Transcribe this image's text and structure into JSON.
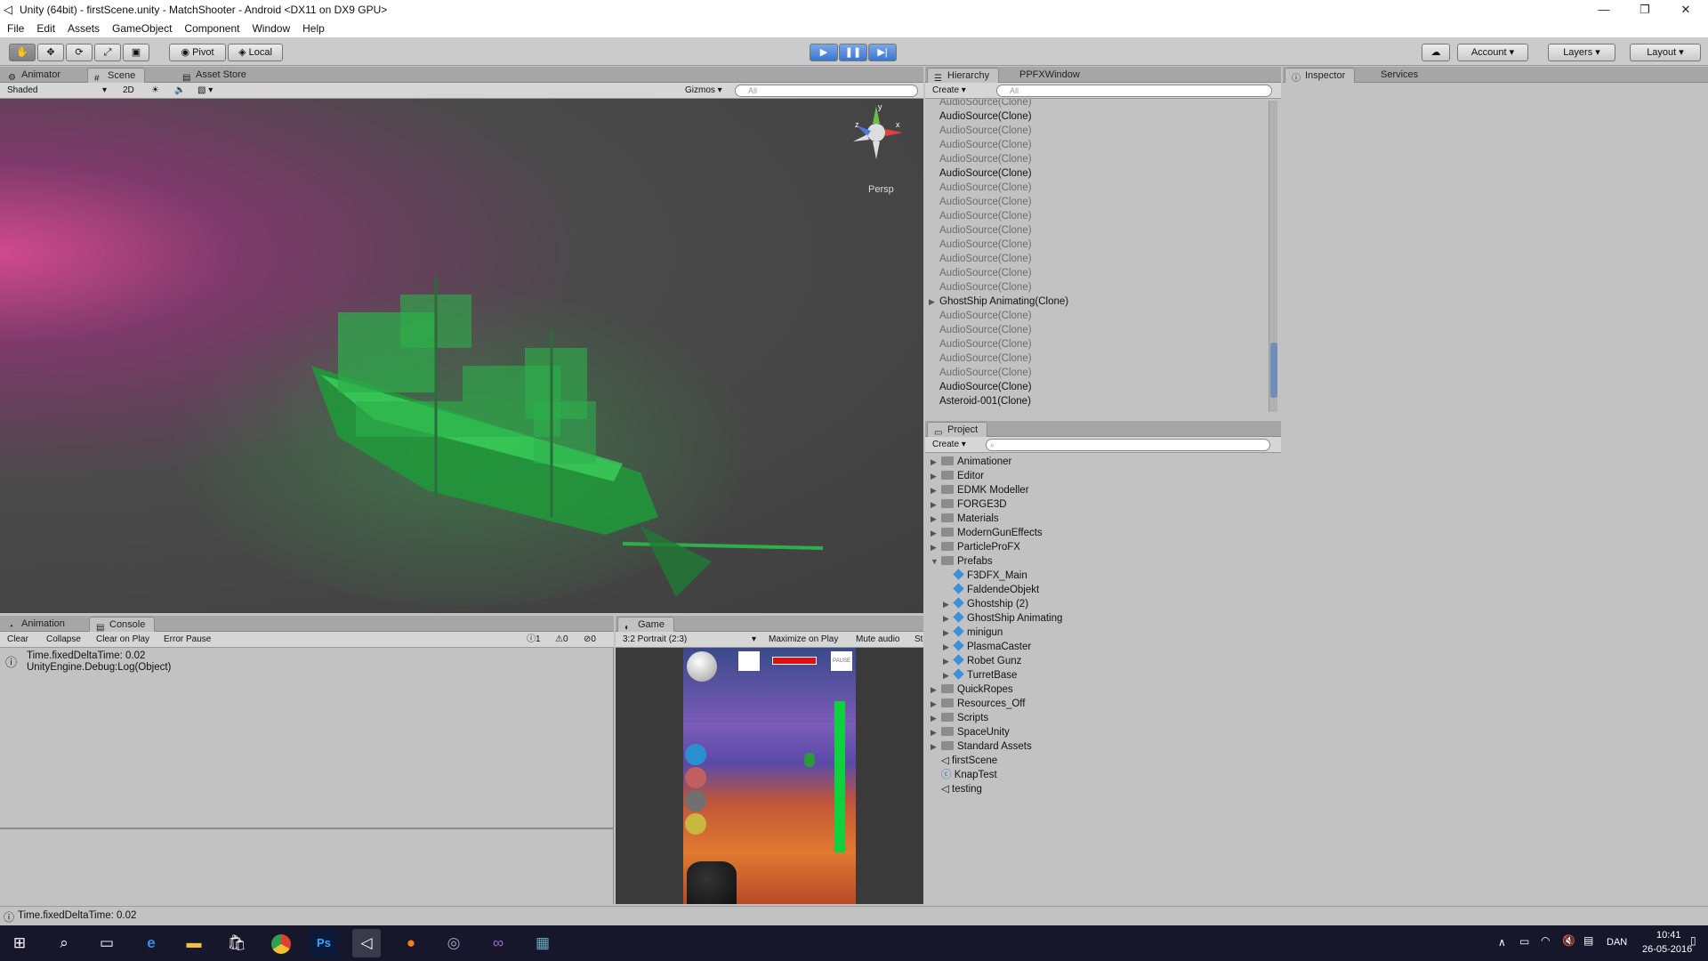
{
  "window": {
    "title": "Unity (64bit) - firstScene.unity - MatchShooter - Android <DX11 on DX9 GPU>",
    "minimize": "—",
    "restore": "❐",
    "close": "✕"
  },
  "menu": [
    "File",
    "Edit",
    "Assets",
    "GameObject",
    "Component",
    "Window",
    "Help"
  ],
  "toolbar": {
    "pivot": "Pivot",
    "local": "Local",
    "account": "Account",
    "layers": "Layers",
    "layout": "Layout",
    "tools": [
      "hand",
      "move",
      "rotate",
      "scale",
      "rect"
    ]
  },
  "scene_panel": {
    "tabs": [
      "Animator",
      "Scene",
      "Asset Store"
    ],
    "shading": "Shaded",
    "mode_2d": "2D",
    "gizmos": "Gizmos",
    "search_placeholder": "All",
    "persp_label": "Persp",
    "gizmo_axes": {
      "y": "y",
      "x": "x",
      "z": "z"
    }
  },
  "hierarchy": {
    "tabs": [
      "Hierarchy",
      "PPFXWindow"
    ],
    "create": "Create",
    "search_placeholder": "All",
    "items": [
      {
        "label": "AudioSource(Clone)",
        "dim": true
      },
      {
        "label": "AudioSource(Clone)",
        "dim": false
      },
      {
        "label": "AudioSource(Clone)",
        "dim": true
      },
      {
        "label": "AudioSource(Clone)",
        "dim": true
      },
      {
        "label": "AudioSource(Clone)",
        "dim": true
      },
      {
        "label": "AudioSource(Clone)",
        "dim": false
      },
      {
        "label": "AudioSource(Clone)",
        "dim": true
      },
      {
        "label": "AudioSource(Clone)",
        "dim": true
      },
      {
        "label": "AudioSource(Clone)",
        "dim": true
      },
      {
        "label": "AudioSource(Clone)",
        "dim": true
      },
      {
        "label": "AudioSource(Clone)",
        "dim": true
      },
      {
        "label": "AudioSource(Clone)",
        "dim": true
      },
      {
        "label": "AudioSource(Clone)",
        "dim": true
      },
      {
        "label": "AudioSource(Clone)",
        "dim": true
      },
      {
        "label": "GhostShip Animating(Clone)",
        "dim": false,
        "expandable": true
      },
      {
        "label": "AudioSource(Clone)",
        "dim": true
      },
      {
        "label": "AudioSource(Clone)",
        "dim": true
      },
      {
        "label": "AudioSource(Clone)",
        "dim": true
      },
      {
        "label": "AudioSource(Clone)",
        "dim": true
      },
      {
        "label": "AudioSource(Clone)",
        "dim": true
      },
      {
        "label": "AudioSource(Clone)",
        "dim": false
      },
      {
        "label": "Asteroid-001(Clone)",
        "dim": false
      }
    ]
  },
  "project": {
    "tab": "Project",
    "create": "Create",
    "items": [
      {
        "label": "Animationer",
        "type": "folder",
        "indent": 0,
        "arrow": "▶"
      },
      {
        "label": "Editor",
        "type": "folder",
        "indent": 0,
        "arrow": "▶"
      },
      {
        "label": "EDMK Modeller",
        "type": "folder",
        "indent": 0,
        "arrow": "▶"
      },
      {
        "label": "FORGE3D",
        "type": "folder",
        "indent": 0,
        "arrow": "▶"
      },
      {
        "label": "Materials",
        "type": "folder",
        "indent": 0,
        "arrow": "▶"
      },
      {
        "label": "ModernGunEffects",
        "type": "folder",
        "indent": 0,
        "arrow": "▶"
      },
      {
        "label": "ParticleProFX",
        "type": "folder",
        "indent": 0,
        "arrow": "▶"
      },
      {
        "label": "Prefabs",
        "type": "folder",
        "indent": 0,
        "arrow": "▼"
      },
      {
        "label": "F3DFX_Main",
        "type": "prefab",
        "indent": 1,
        "arrow": ""
      },
      {
        "label": "FaldendeObjekt",
        "type": "prefab",
        "indent": 1,
        "arrow": ""
      },
      {
        "label": "Ghostship (2)",
        "type": "prefab",
        "indent": 1,
        "arrow": "▶"
      },
      {
        "label": "GhostShip Animating",
        "type": "prefab",
        "indent": 1,
        "arrow": "▶"
      },
      {
        "label": "minigun",
        "type": "prefab",
        "indent": 1,
        "arrow": "▶"
      },
      {
        "label": "PlasmaCaster",
        "type": "prefab",
        "indent": 1,
        "arrow": "▶"
      },
      {
        "label": "Robet Gunz",
        "type": "prefab",
        "indent": 1,
        "arrow": "▶"
      },
      {
        "label": "TurretBase",
        "type": "prefab",
        "indent": 1,
        "arrow": "▶"
      },
      {
        "label": "QuickRopes",
        "type": "folder",
        "indent": 0,
        "arrow": "▶"
      },
      {
        "label": "Resources_Off",
        "type": "folder",
        "indent": 0,
        "arrow": "▶"
      },
      {
        "label": "Scripts",
        "type": "folder",
        "indent": 0,
        "arrow": "▶"
      },
      {
        "label": "SpaceUnity",
        "type": "folder",
        "indent": 0,
        "arrow": "▶"
      },
      {
        "label": "Standard Assets",
        "type": "folder",
        "indent": 0,
        "arrow": "▶"
      },
      {
        "label": "firstScene",
        "type": "scene",
        "indent": 0,
        "arrow": ""
      },
      {
        "label": "KnapTest",
        "type": "script",
        "indent": 0,
        "arrow": ""
      },
      {
        "label": "testing",
        "type": "scene",
        "indent": 0,
        "arrow": ""
      }
    ]
  },
  "inspector": {
    "tabs": [
      "Inspector",
      "Services"
    ]
  },
  "console": {
    "tabs": [
      "Animation",
      "Console"
    ],
    "buttons": [
      "Clear",
      "Collapse",
      "Clear on Play",
      "Error Pause"
    ],
    "counts": {
      "info": "1",
      "warn": "0",
      "error": "0"
    },
    "entry_line1": "Time.fixedDeltaTime: 0.02",
    "entry_line2": "UnityEngine.Debug:Log(Object)"
  },
  "game": {
    "tab": "Game",
    "aspect": "3:2 Portrait (2:3)",
    "maximize": "Maximize on Play",
    "mute": "Mute audio",
    "stats": "St",
    "pause_label": "PAUSE",
    "health_fraction": 1.0,
    "energy_fraction": 1.0
  },
  "status": {
    "text": "Time.fixedDeltaTime: 0.02"
  },
  "taskbar": {
    "lang": "DAN",
    "time": "10:41",
    "date": "26-05-2016",
    "icons": [
      "start-icon",
      "search-icon",
      "task-view-icon",
      "edge-icon",
      "explorer-icon",
      "store-icon",
      "chrome-icon",
      "photoshop-icon",
      "unity-icon",
      "firefox-icon",
      "globe-app-icon",
      "visual-studio-icon",
      "app-icon"
    ]
  }
}
